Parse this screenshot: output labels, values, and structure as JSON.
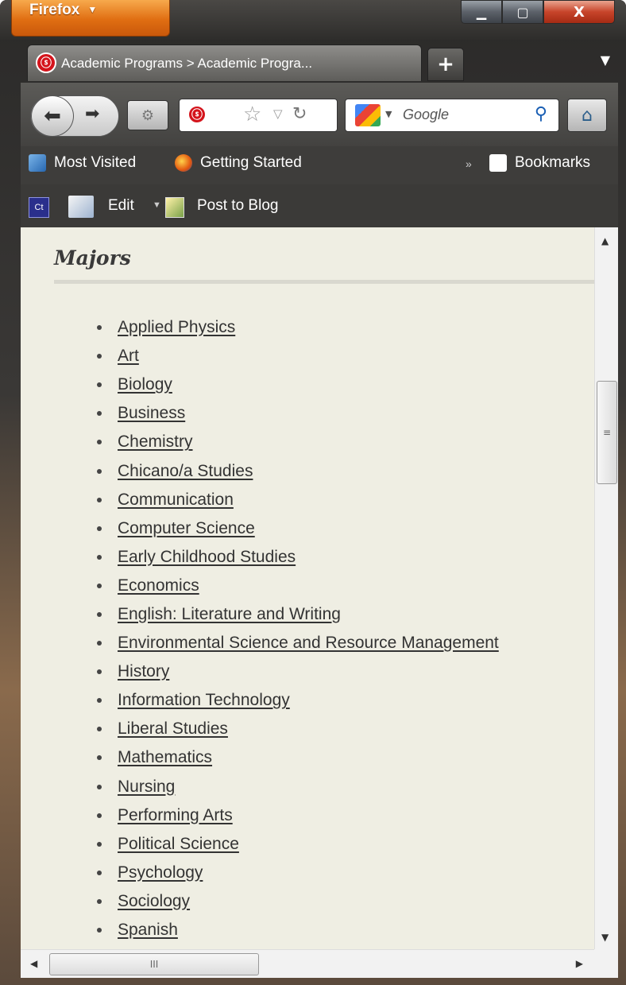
{
  "browser": {
    "menu_label": "Firefox",
    "window_controls": {
      "minimize": "▁",
      "maximize": "▢",
      "close": "X"
    }
  },
  "tab": {
    "title": "Academic Programs > Academic Progra...",
    "favicon": "csuci-logo-icon",
    "new_tab": "+"
  },
  "nav": {
    "search_placeholder": "Google",
    "icons": [
      "back-icon",
      "forward-icon",
      "site-identity-icon",
      "star-icon",
      "reload-icon",
      "google-icon",
      "search-icon",
      "home-icon"
    ]
  },
  "bookmarks": {
    "most_visited": "Most Visited",
    "getting_started": "Getting Started",
    "bookmarks_label": "Bookmarks",
    "overflow": "»"
  },
  "toolbar": {
    "ct_label": "Ct",
    "edit_label": "Edit",
    "post_label": "Post to Blog"
  },
  "page": {
    "heading": "Majors",
    "majors": [
      "Applied Physics",
      "Art",
      "Biology",
      "Business",
      "Chemistry",
      "Chicano/a Studies",
      "Communication",
      "Computer Science",
      "Early Childhood Studies",
      "Economics",
      "English: Literature and Writing",
      "Environmental Science and Resource Management",
      "History",
      "Information Technology",
      "Liberal Studies",
      "Mathematics",
      "Nursing",
      "Performing Arts",
      "Political Science",
      "Psychology",
      "Sociology",
      "Spanish"
    ]
  }
}
